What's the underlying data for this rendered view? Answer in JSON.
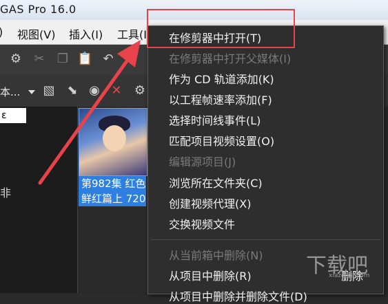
{
  "window": {
    "title": "GAS Pro 16.0"
  },
  "menubar": {
    "items": [
      "视图(V)",
      "插入(I)",
      "工具(I)"
    ]
  },
  "section_toolbar": {
    "crumb": "本..."
  },
  "left_pane": {
    "selected": "ε",
    "glyph": "非"
  },
  "media": {
    "label_line1": "第982集 红色",
    "label_line2": "鲜红篇上 720"
  },
  "context_menu": {
    "items": [
      {
        "label": "在修剪器中打开(T)",
        "disabled": false
      },
      {
        "label": "在修剪器中打开父媒体(I)",
        "disabled": true
      },
      {
        "label": "作为 CD 轨道添加(K)",
        "disabled": false
      },
      {
        "label": "以工程帧速率添加(F)",
        "disabled": false
      },
      {
        "label": "选择时间线事件(L)",
        "disabled": false
      },
      {
        "label": "匹配项目视频设置(O)",
        "disabled": false
      },
      {
        "label": "编辑源项目(J)",
        "disabled": true
      },
      {
        "label": "浏览所在文件夹(C)",
        "disabled": false
      },
      {
        "label": "创建视频代理(X)",
        "disabled": false
      },
      {
        "label": "交换视频文件",
        "disabled": false
      },
      {
        "label": "从当前箱中删除(N)",
        "disabled": true
      },
      {
        "label": "从项目中删除(R)",
        "disabled": false
      },
      {
        "label": "从项目中删除并删除文件(D)",
        "disabled": false
      }
    ],
    "shortcut_delete": "删除"
  },
  "watermark": {
    "text": "xiazaiba.com"
  }
}
